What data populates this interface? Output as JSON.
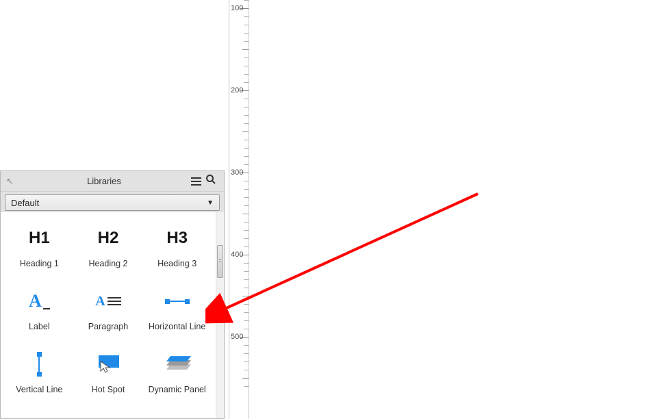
{
  "panel": {
    "title": "Libraries",
    "selected": "Default"
  },
  "widgets": {
    "h1": {
      "icon": "H1",
      "label": "Heading 1"
    },
    "h2": {
      "icon": "H2",
      "label": "Heading 2"
    },
    "h3": {
      "icon": "H3",
      "label": "Heading 3"
    },
    "label": {
      "label": "Label"
    },
    "paragraph": {
      "label": "Paragraph"
    },
    "hline": {
      "label": "Horizontal Line"
    },
    "vline": {
      "label": "Vertical Line"
    },
    "hotspot": {
      "label": "Hot Spot"
    },
    "dynpanel": {
      "label": "Dynamic Panel"
    }
  },
  "ruler": {
    "majors": [
      100,
      200,
      300,
      400,
      500
    ]
  }
}
